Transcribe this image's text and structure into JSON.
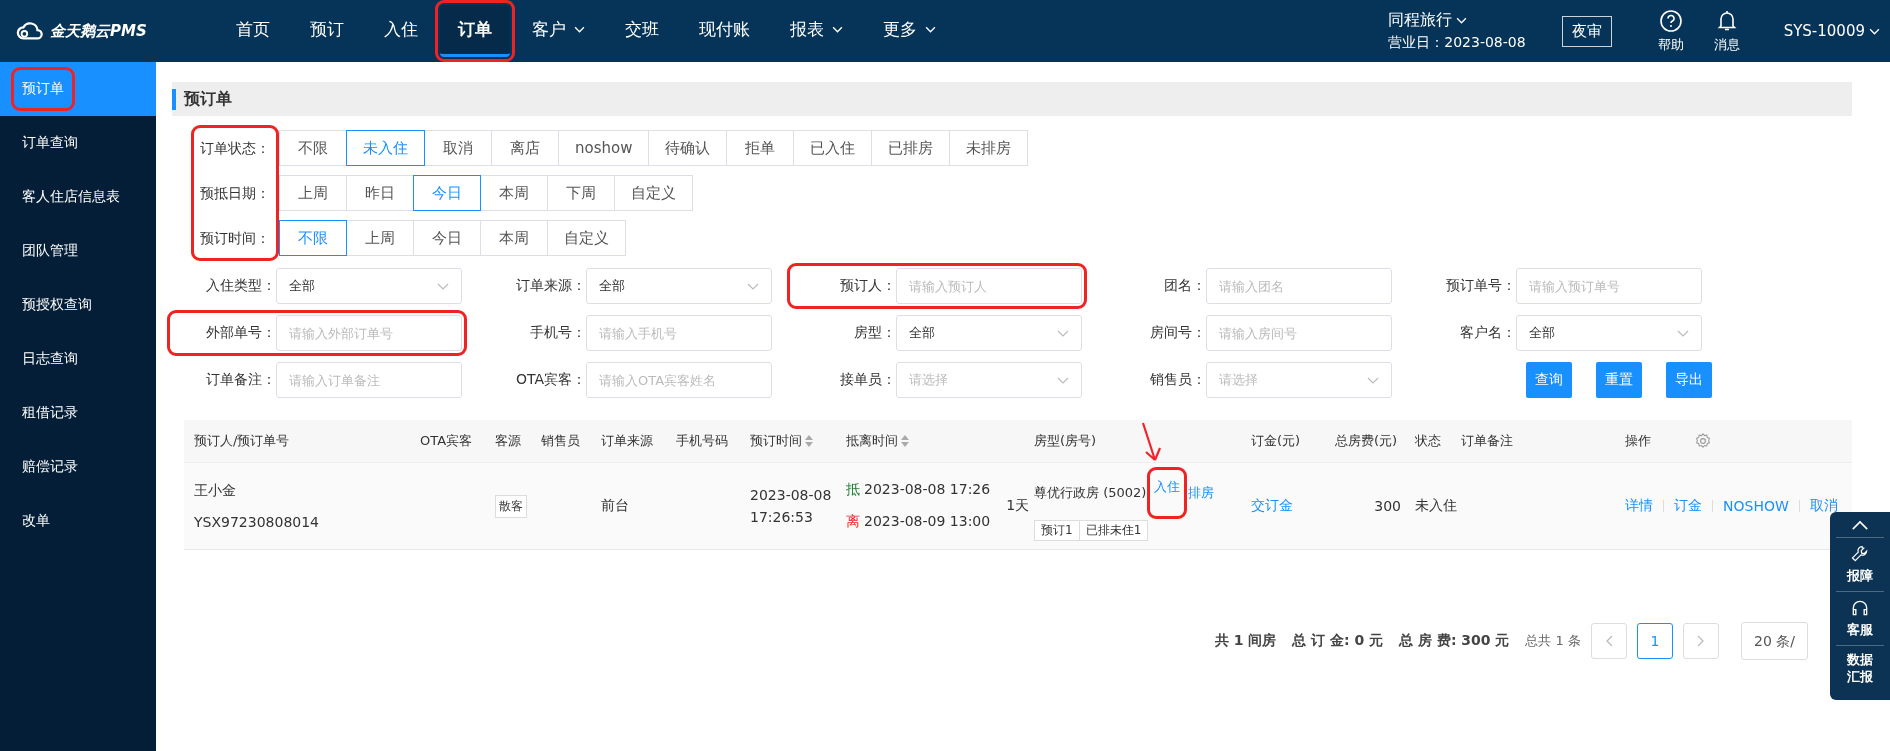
{
  "brand": {
    "name": "金天鹅云PMS"
  },
  "nav": [
    {
      "label": "首页",
      "dropdown": false,
      "selected": false,
      "annotated": false
    },
    {
      "label": "预订",
      "dropdown": false,
      "selected": false,
      "annotated": false
    },
    {
      "label": "入住",
      "dropdown": false,
      "selected": false,
      "annotated": false
    },
    {
      "label": "订单",
      "dropdown": false,
      "selected": true,
      "annotated": true
    },
    {
      "label": "客户",
      "dropdown": true,
      "selected": false,
      "annotated": false
    },
    {
      "label": "交班",
      "dropdown": false,
      "selected": false,
      "annotated": false
    },
    {
      "label": "现付账",
      "dropdown": false,
      "selected": false,
      "annotated": false
    },
    {
      "label": "报表",
      "dropdown": true,
      "selected": false,
      "annotated": false
    },
    {
      "label": "更多",
      "dropdown": true,
      "selected": false,
      "annotated": false
    }
  ],
  "header_right": {
    "company": "同程旅行",
    "business_date": "营业日：2023-08-08",
    "night_audit": "夜审",
    "help": "帮助",
    "messages": "消息",
    "user": "SYS-10009"
  },
  "sidebar": [
    {
      "label": "预订单",
      "selected": true,
      "annotated": true
    },
    {
      "label": "订单查询",
      "selected": false,
      "annotated": false
    },
    {
      "label": "客人住店信息表",
      "selected": false,
      "annotated": false
    },
    {
      "label": "团队管理",
      "selected": false,
      "annotated": false
    },
    {
      "label": "预授权查询",
      "selected": false,
      "annotated": false
    },
    {
      "label": "日志查询",
      "selected": false,
      "annotated": false
    },
    {
      "label": "租借记录",
      "selected": false,
      "annotated": false
    },
    {
      "label": "赔偿记录",
      "selected": false,
      "annotated": false
    },
    {
      "label": "改单",
      "selected": false,
      "annotated": false
    }
  ],
  "page_title": "预订单",
  "filter_labels_annotated": true,
  "filters": [
    {
      "label": "订单状态：",
      "options": [
        {
          "label": "不限",
          "selected": false
        },
        {
          "label": "未入住",
          "selected": true
        },
        {
          "label": "取消",
          "selected": false
        },
        {
          "label": "离店",
          "selected": false
        },
        {
          "label": "noshow",
          "selected": false
        },
        {
          "label": "待确认",
          "selected": false
        },
        {
          "label": "拒单",
          "selected": false
        },
        {
          "label": "已入住",
          "selected": false
        },
        {
          "label": "已排房",
          "selected": false
        },
        {
          "label": "未排房",
          "selected": false
        }
      ]
    },
    {
      "label": "预抵日期：",
      "options": [
        {
          "label": "上周",
          "selected": false
        },
        {
          "label": "昨日",
          "selected": false
        },
        {
          "label": "今日",
          "selected": true
        },
        {
          "label": "本周",
          "selected": false
        },
        {
          "label": "下周",
          "selected": false
        },
        {
          "label": "自定义",
          "selected": false
        }
      ]
    },
    {
      "label": "预订时间：",
      "options": [
        {
          "label": "不限",
          "selected": true
        },
        {
          "label": "上周",
          "selected": false
        },
        {
          "label": "今日",
          "selected": false
        },
        {
          "label": "本周",
          "selected": false
        },
        {
          "label": "自定义",
          "selected": false
        }
      ]
    }
  ],
  "fields": [
    {
      "label": "入住类型：",
      "kind": "select",
      "value": "全部",
      "annotated": false
    },
    {
      "label": "订单来源：",
      "kind": "select",
      "value": "全部",
      "annotated": false
    },
    {
      "label": "预订人：",
      "kind": "input",
      "placeholder": "请输入预订人",
      "annotated": true
    },
    {
      "label": "团名：",
      "kind": "input",
      "placeholder": "请输入团名",
      "annotated": false
    },
    {
      "label": "预订单号：",
      "kind": "input",
      "placeholder": "请输入预订单号",
      "annotated": false
    },
    {
      "label": "外部单号：",
      "kind": "input",
      "placeholder": "请输入外部订单号",
      "annotated": true
    },
    {
      "label": "手机号：",
      "kind": "input",
      "placeholder": "请输入手机号",
      "annotated": false
    },
    {
      "label": "房型：",
      "kind": "select",
      "value": "全部",
      "annotated": false
    },
    {
      "label": "房间号：",
      "kind": "input",
      "placeholder": "请输入房间号",
      "annotated": false
    },
    {
      "label": "客户名：",
      "kind": "select",
      "value": "全部",
      "annotated": false
    },
    {
      "label": "订单备注：",
      "kind": "input",
      "placeholder": "请输入订单备注",
      "annotated": false
    },
    {
      "label": "OTA宾客：",
      "kind": "input",
      "placeholder": "请输入OTA宾客姓名",
      "annotated": false
    },
    {
      "label": "接单员：",
      "kind": "select",
      "placeholder": "请选择",
      "annotated": false
    },
    {
      "label": "销售员：",
      "kind": "select",
      "placeholder": "请选择",
      "annotated": false
    }
  ],
  "buttons": [
    "查询",
    "重置",
    "导出"
  ],
  "table": {
    "columns": [
      {
        "label": "预订人/预订单号",
        "sortable": false
      },
      {
        "label": "OTA宾客",
        "sortable": false
      },
      {
        "label": "客源",
        "sortable": false
      },
      {
        "label": "销售员",
        "sortable": false
      },
      {
        "label": "订单来源",
        "sortable": false
      },
      {
        "label": "手机号码",
        "sortable": false
      },
      {
        "label": "预订时间",
        "sortable": true
      },
      {
        "label": "抵离时间",
        "sortable": true
      },
      {
        "label": "房型(房号)",
        "sortable": false
      },
      {
        "label": "订金(元)",
        "sortable": false
      },
      {
        "label": "总房费(元)",
        "sortable": false
      },
      {
        "label": "状态",
        "sortable": false
      },
      {
        "label": "订单备注",
        "sortable": false
      },
      {
        "label": "操作",
        "sortable": false
      }
    ],
    "rows": [
      {
        "booker": "王小金",
        "order_no": "YSX97230808014",
        "source_tag": "散客",
        "channel": "前台",
        "booked_at": "2023-08-08 17:26:53",
        "stay": [
          {
            "mark": "抵",
            "color": "#1e7b34",
            "datetime": "2023-08-08 17:26"
          },
          {
            "mark": "离",
            "color": "#f5222d",
            "datetime": "2023-08-09 13:00"
          }
        ],
        "nights": "1天",
        "room": "尊优行政房 (5002)",
        "room_actions": [
          {
            "label": "入住",
            "annotated": true
          },
          {
            "label": "排房",
            "annotated": false
          }
        ],
        "room_tags": [
          "预订1",
          "已排未住1"
        ],
        "deposit_action": "交订金",
        "total": "300",
        "status": "未入住",
        "actions": [
          "详情",
          "订金",
          "NOSHOW",
          "取消"
        ]
      }
    ]
  },
  "summary": [
    "共 1 间房",
    "总 订 金: 0 元",
    "总 房 费: 300 元"
  ],
  "pagination": {
    "total": "总共 1 条",
    "pages": [
      {
        "label": "1",
        "selected": true
      }
    ],
    "page_size": "20 条/"
  },
  "side_widget": [
    {
      "kind": "wrench",
      "label": "报障"
    },
    {
      "kind": "headset",
      "label": "客服"
    },
    {
      "kind": "text",
      "label": "数据汇报"
    }
  ]
}
